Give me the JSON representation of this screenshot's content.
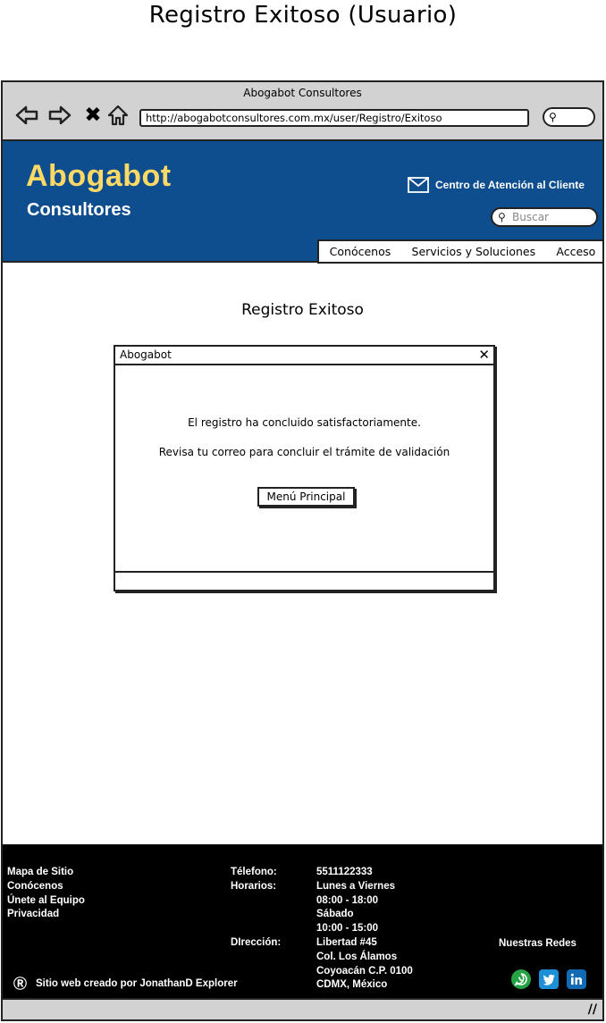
{
  "page": {
    "title": "Registro Exitoso (Usuario)"
  },
  "browser": {
    "title": "Abogabot Consultores",
    "url": "http://abogabotconsultores.com.mx/user/Registro/Exitoso"
  },
  "header": {
    "logo_main": "Abogabot",
    "logo_sub": "Consultores",
    "support_label": "Centro de Atención al Cliente",
    "search_placeholder": "Buscar",
    "menu": [
      "Conócenos",
      "Servicios y Soluciones",
      "Acceso"
    ]
  },
  "content": {
    "title": "Registro Exitoso"
  },
  "dialog": {
    "title": "Abogabot",
    "message1": "El registro ha concluido satisfactoriamente.",
    "message2": "Revisa tu correo para concluir el trámite de validación",
    "button": "Menú Principal"
  },
  "footer": {
    "links": [
      "Mapa de Sitio",
      "Conócenos",
      "Únete al Equipo",
      "Privacidad"
    ],
    "phone_label": "Télefono:",
    "phone": "5511122333",
    "hours_label": "Horarios:",
    "hours": [
      "Lunes a Viernes",
      "08:00 - 18:00",
      "Sábado",
      "10:00 - 15:00"
    ],
    "address_label": "DIrección:",
    "address": [
      "Libertad #45",
      "Col. Los Álamos",
      "Coyoacán C.P. 0100",
      "CDMX, México"
    ],
    "social_title": "Nuestras Redes",
    "credit": "Sitio web creado por JonathanD Explorer",
    "credit_icon": "Ⓡ",
    "socials": [
      {
        "name": "whatsapp",
        "color": "#25a244"
      },
      {
        "name": "twitter",
        "color": "#1d8fd6"
      },
      {
        "name": "linkedin",
        "color": "#1269b3"
      }
    ]
  },
  "colors": {
    "header_bg": "#0f4e8e",
    "logo_accent": "#ffd966",
    "footer_bg": "#000000",
    "chrome": "#d2d2d2"
  }
}
